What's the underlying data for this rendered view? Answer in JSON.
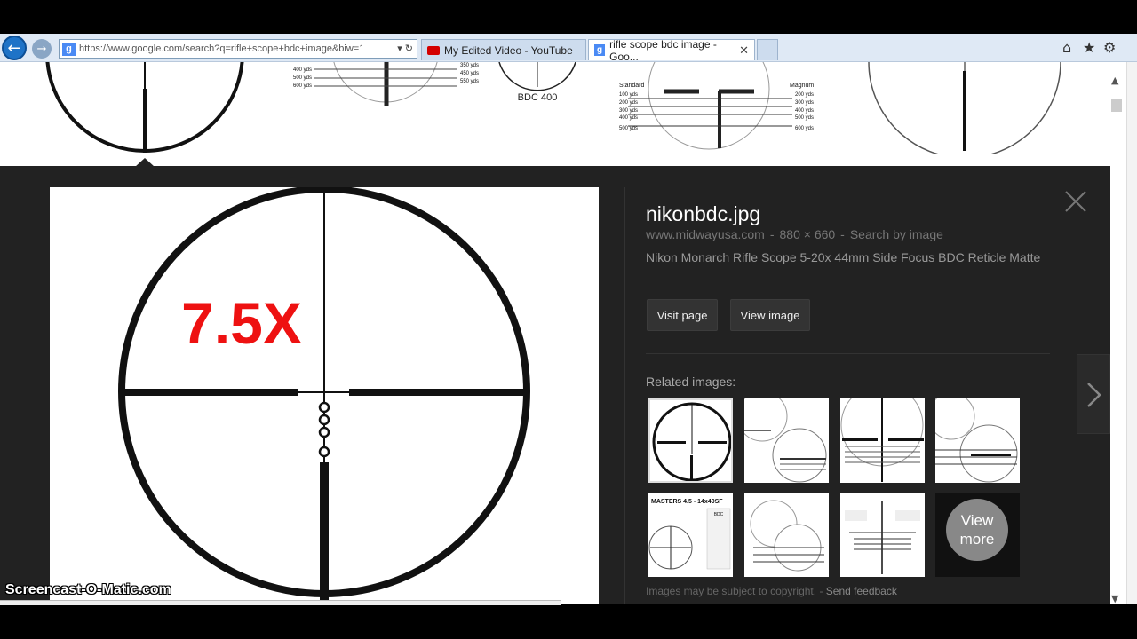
{
  "browser": {
    "address": "https://www.google.com/search?q=rifle+scope+bdc+image&biw=1",
    "tabs": [
      {
        "label": "My Edited Video - YouTube"
      },
      {
        "label": "rifle scope bdc image - Goo..."
      }
    ],
    "toolbar_icons": [
      "home-icon",
      "star-icon",
      "gear-icon"
    ]
  },
  "thumbnails": {
    "bdc_label": "BDC 400",
    "yardage_labels_a": [
      "400 yds",
      "500 yds",
      "600 yds"
    ],
    "yardage_labels_b": [
      "350 yds",
      "450 yds",
      "550 yds"
    ],
    "standard_label": "Standard",
    "magnum_label": "Magnum",
    "standard_yds": [
      "100 yds",
      "200 yds",
      "300 yds",
      "400 yds",
      "500 yds"
    ],
    "magnum_yds": [
      "200 yds",
      "300 yds",
      "400 yds",
      "500 yds",
      "600 yds"
    ]
  },
  "preview": {
    "zoom_label": "7.5X",
    "zoom_color": "#ee1111",
    "title": "nikonbdc.jpg",
    "source": "www.midwayusa.com",
    "dimensions": "880 × 660",
    "search_by_image": "Search by image",
    "description": "Nikon Monarch Rifle Scope 5-20x 44mm Side Focus BDC Reticle Matte",
    "visit_button": "Visit page",
    "view_button": "View image",
    "related_heading": "Related images:",
    "view_more": "View more",
    "related_texts": [
      "MASTERS 4.5 - 14x40SF",
      "BDC"
    ],
    "copyright": "Images may be subject to copyright.",
    "feedback": "Send feedback"
  },
  "watermark": "Screencast-O-Matic.com"
}
